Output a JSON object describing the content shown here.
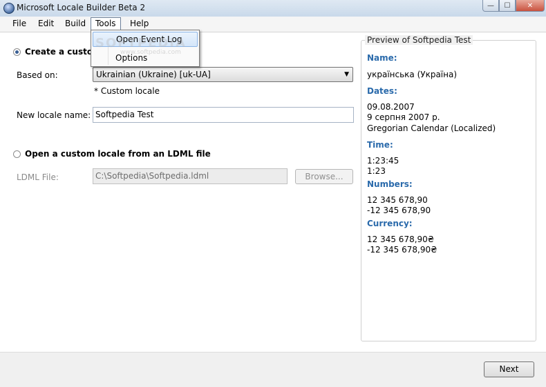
{
  "window": {
    "title": "Microsoft Locale Builder Beta 2",
    "controls": {
      "minimize": "—",
      "maximize": "☐",
      "close": "✕"
    }
  },
  "menu": {
    "items": [
      "File",
      "Edit",
      "Build",
      "Tools",
      "Help"
    ],
    "active": "Tools",
    "dropdown": [
      "Open Event Log",
      "Options"
    ],
    "highlighted": "Open Event Log"
  },
  "watermark": {
    "text": "SOFTPEDIA",
    "sub": "www.softpedia.com"
  },
  "form": {
    "create_label": "Create a custom",
    "based_on_label": "Based on:",
    "based_on_value": "Ukrainian (Ukraine) [uk-UA]",
    "custom_locale_note": "* Custom locale",
    "new_locale_label": "New locale name:",
    "new_locale_value": "Softpedia Test",
    "open_ldml_label": "Open a custom locale from an LDML file",
    "ldml_file_label": "LDML File:",
    "ldml_file_value": "C:\\Softpedia\\Softpedia.ldml",
    "browse_label": "Browse..."
  },
  "preview": {
    "title": "Preview of Softpedia Test",
    "name_heading": "Name:",
    "name_value": "українська (Україна)",
    "dates_heading": "Dates:",
    "dates_short": "09.08.2007",
    "dates_long": "9 серпня 2007 р.",
    "dates_calendar": "Gregorian Calendar (Localized)",
    "time_heading": "Time:",
    "time_long": "1:23:45",
    "time_short": "1:23",
    "numbers_heading": "Numbers:",
    "numbers_pos": "12 345 678,90",
    "numbers_neg": "-12 345 678,90",
    "currency_heading": "Currency:",
    "currency_pos": "12 345 678,90₴",
    "currency_neg": "-12 345 678,90₴"
  },
  "footer": {
    "next_label": "Next"
  },
  "colors": {
    "heading_blue": "#2a6aab",
    "radio_dot": "#3a5f94"
  }
}
